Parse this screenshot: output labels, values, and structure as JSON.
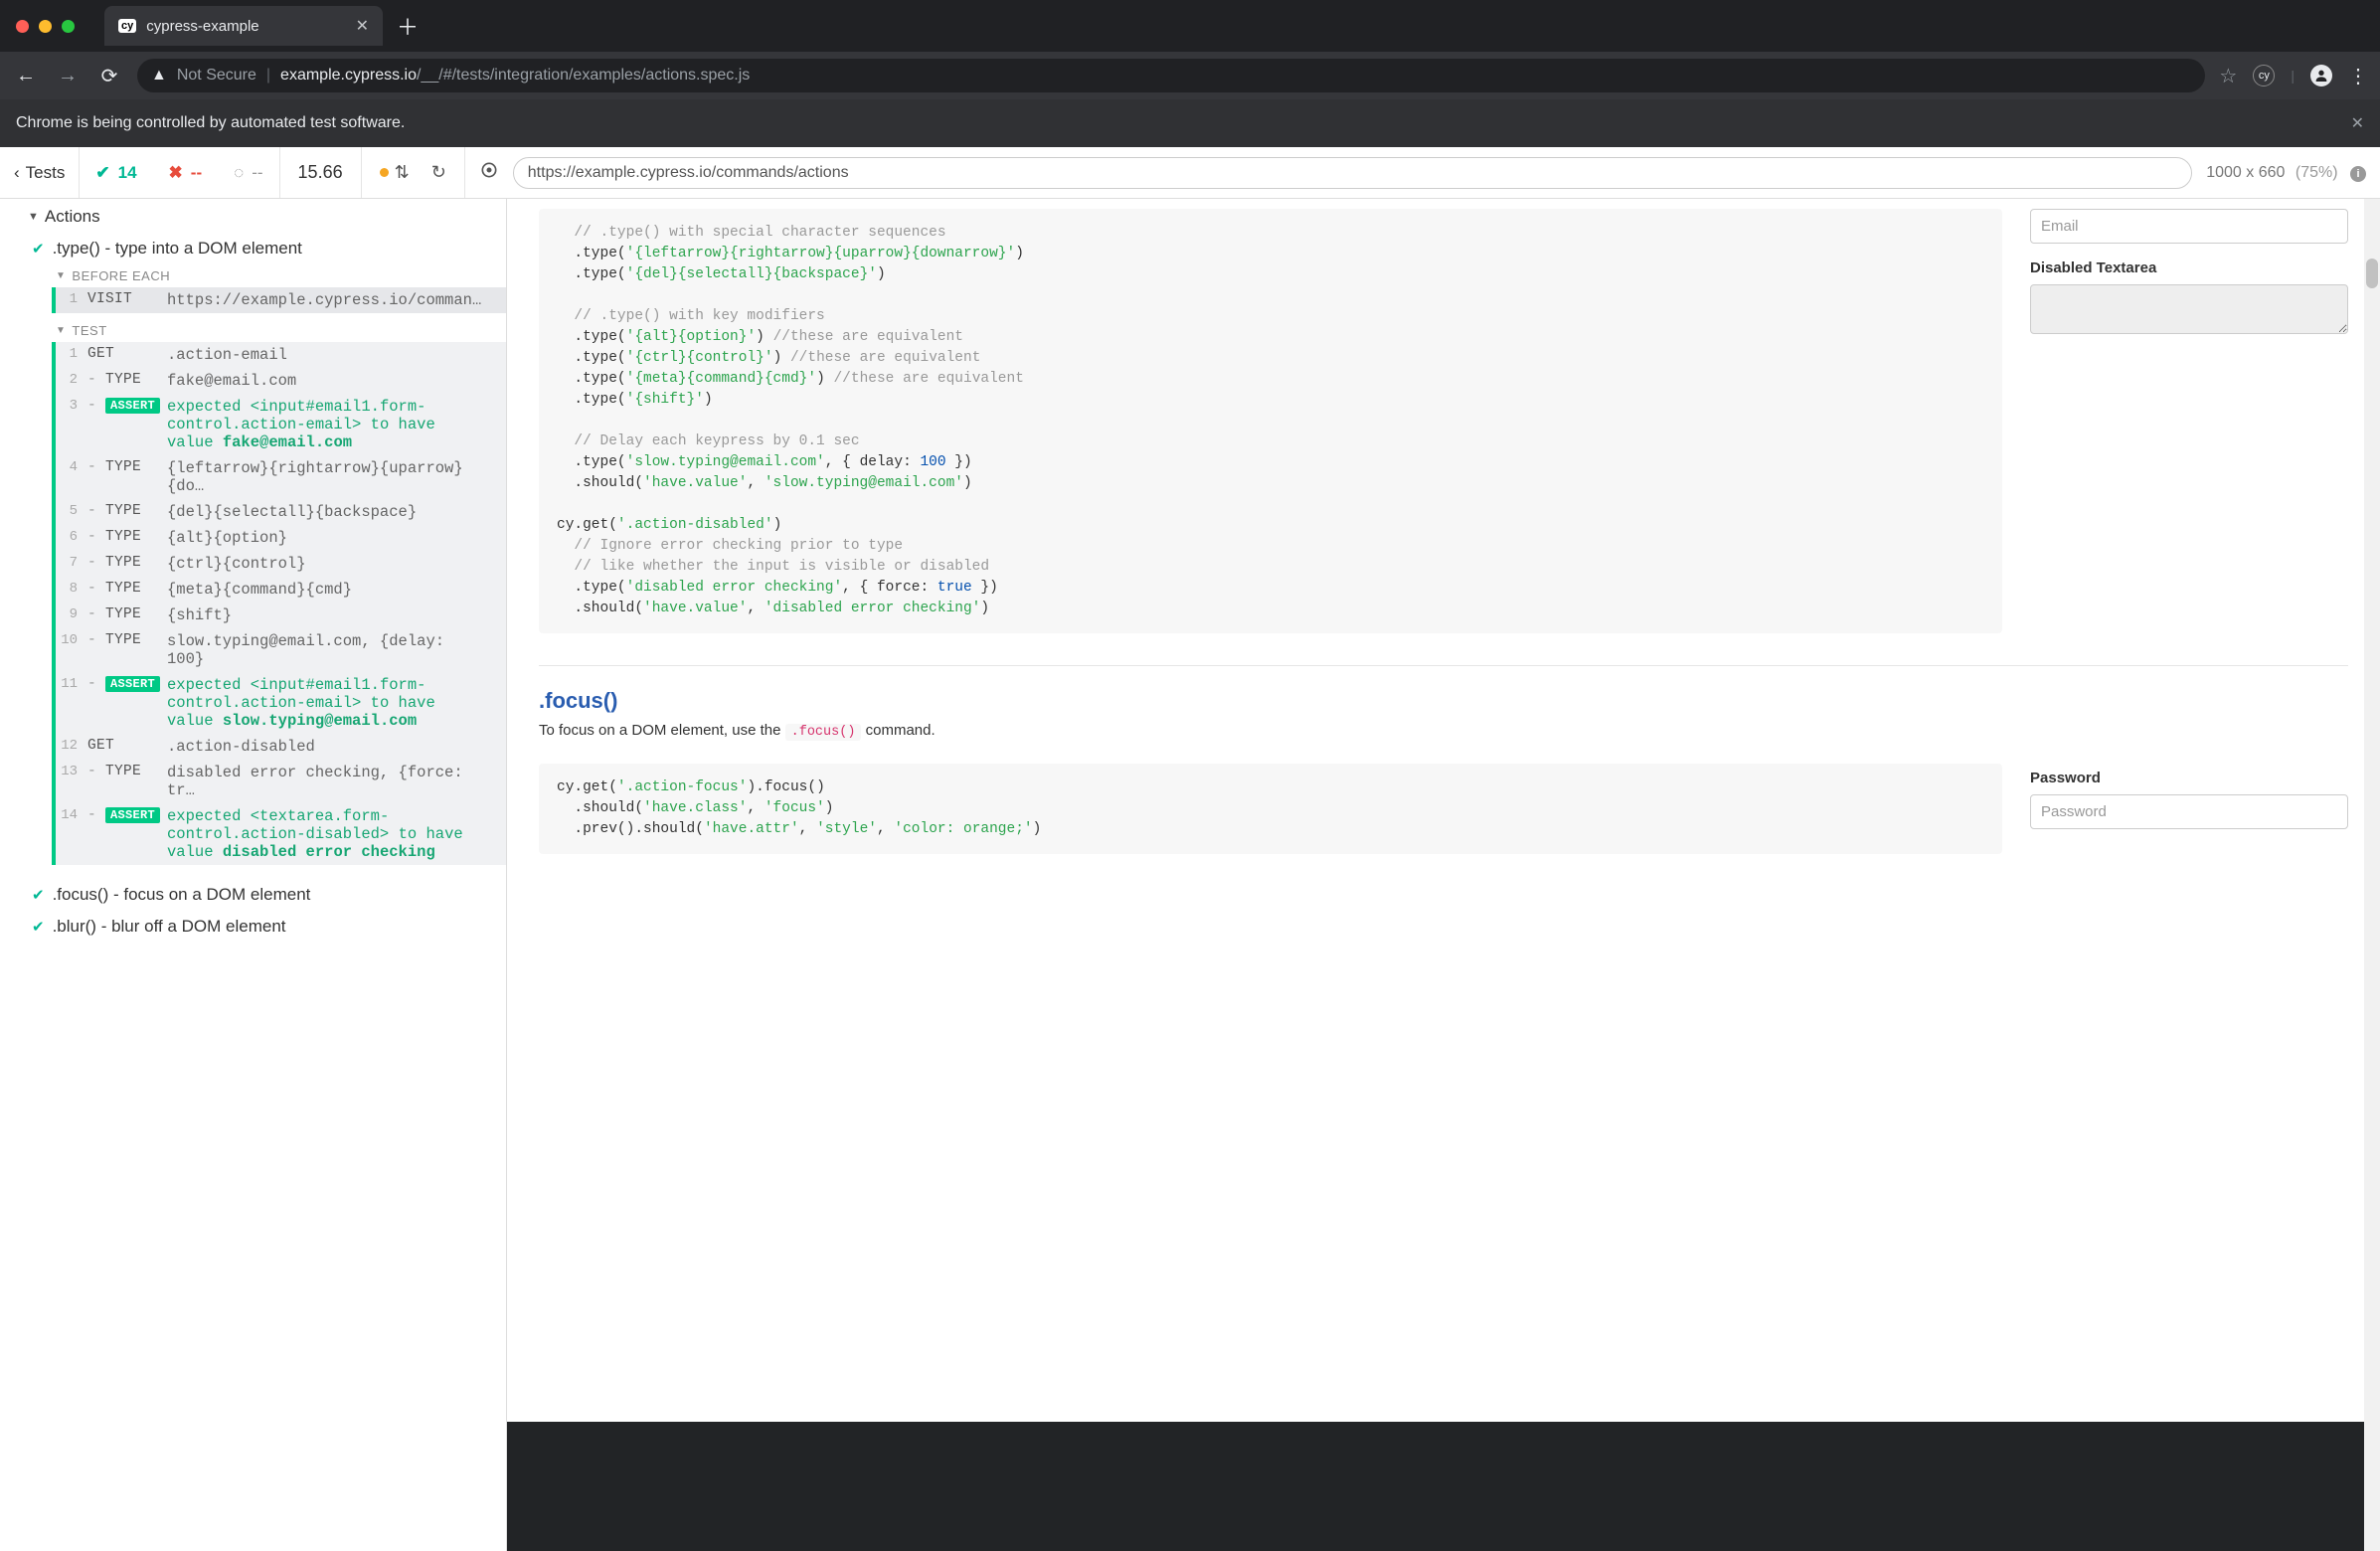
{
  "browser": {
    "tab_favicon": "cy",
    "tab_title": "cypress-example",
    "address_insecure": "Not Secure",
    "address_host": "example.cypress.io",
    "address_path": "/__/#/tests/integration/examples/actions.spec.js",
    "cy_badge": "cy"
  },
  "infobar": {
    "text": "Chrome is being controlled by automated test software."
  },
  "header": {
    "tests_label": "Tests",
    "passed": "14",
    "failed": "--",
    "pending": "--",
    "duration": "15.66",
    "aut_url": "https://example.cypress.io/commands/actions",
    "viewport": "1000 x 660",
    "scale": "(75%)"
  },
  "reporter": {
    "suite": "Actions",
    "tests": [
      {
        "status": "pass",
        "title": ".type() - type into a DOM element"
      },
      {
        "status": "pass",
        "title": ".focus() - focus on a DOM element"
      },
      {
        "status": "pass",
        "title": ".blur() - blur off a DOM element"
      }
    ],
    "hooks": {
      "before_each": "BEFORE EACH",
      "test": "TEST"
    },
    "before_each_cmd": {
      "num": "1",
      "name": "VISIT",
      "msg": "https://example.cypress.io/commands…"
    },
    "cmds": [
      {
        "num": "1",
        "name": "GET",
        "child": false,
        "msg": ".action-email"
      },
      {
        "num": "2",
        "name": "TYPE",
        "child": true,
        "msg": "fake@email.com"
      },
      {
        "num": "3",
        "name": "ASSERT",
        "child": true,
        "assert": true,
        "expected": "expected",
        "el": "<input#email1.form-control.action-email>",
        "kw": "to have value",
        "val": "fake@email.com"
      },
      {
        "num": "4",
        "name": "TYPE",
        "child": true,
        "msg": "{leftarrow}{rightarrow}{uparrow}{do…"
      },
      {
        "num": "5",
        "name": "TYPE",
        "child": true,
        "msg": "{del}{selectall}{backspace}"
      },
      {
        "num": "6",
        "name": "TYPE",
        "child": true,
        "msg": "{alt}{option}"
      },
      {
        "num": "7",
        "name": "TYPE",
        "child": true,
        "msg": "{ctrl}{control}"
      },
      {
        "num": "8",
        "name": "TYPE",
        "child": true,
        "msg": "{meta}{command}{cmd}"
      },
      {
        "num": "9",
        "name": "TYPE",
        "child": true,
        "msg": "{shift}"
      },
      {
        "num": "10",
        "name": "TYPE",
        "child": true,
        "msg": "slow.typing@email.com, {delay: 100}"
      },
      {
        "num": "11",
        "name": "ASSERT",
        "child": true,
        "assert": true,
        "expected": "expected",
        "el": "<input#email1.form-control.action-email>",
        "kw": "to have value",
        "val": "slow.typing@email.com"
      },
      {
        "num": "12",
        "name": "GET",
        "child": false,
        "msg": ".action-disabled"
      },
      {
        "num": "13",
        "name": "TYPE",
        "child": true,
        "msg": "disabled error checking, {force: tr…"
      },
      {
        "num": "14",
        "name": "ASSERT",
        "child": true,
        "assert": true,
        "expected": "expected",
        "el": "<textarea.form-control.action-disabled>",
        "kw": "to have value",
        "val": "disabled error checking"
      }
    ]
  },
  "aut": {
    "email_placeholder": "Email",
    "disabled_label": "Disabled Textarea",
    "focus_title": ".focus()",
    "focus_desc_pre": "To focus on a DOM element, use the ",
    "focus_desc_code": ".focus()",
    "focus_desc_post": " command.",
    "password_label": "Password",
    "password_placeholder": "Password",
    "code1_lines": [
      {
        "t": "  ",
        "c": "// .type() with special character sequences"
      },
      {
        "t": "  .type(",
        "s": "'{leftarrow}{rightarrow}{uparrow}{downarrow}'",
        "t2": ")"
      },
      {
        "t": "  .type(",
        "s": "'{del}{selectall}{backspace}'",
        "t2": ")"
      },
      {
        "blank": true
      },
      {
        "t": "  ",
        "c": "// .type() with key modifiers"
      },
      {
        "t": "  .type(",
        "s": "'{alt}{option}'",
        "t2": ") ",
        "c2": "//these are equivalent"
      },
      {
        "t": "  .type(",
        "s": "'{ctrl}{control}'",
        "t2": ") ",
        "c2": "//these are equivalent"
      },
      {
        "t": "  .type(",
        "s": "'{meta}{command}{cmd}'",
        "t2": ") ",
        "c2": "//these are equivalent"
      },
      {
        "t": "  .type(",
        "s": "'{shift}'",
        "t2": ")"
      },
      {
        "blank": true
      },
      {
        "t": "  ",
        "c": "// Delay each keypress by 0.1 sec"
      },
      {
        "t": "  .type(",
        "s": "'slow.typing@email.com'",
        "t2": ", { delay: ",
        "n": "100",
        "t3": " })"
      },
      {
        "t": "  .should(",
        "s": "'have.value'",
        "t2": ", ",
        "s2": "'slow.typing@email.com'",
        "t3": ")"
      },
      {
        "blank": true
      },
      {
        "t": "cy.get(",
        "s": "'.action-disabled'",
        "t2": ")"
      },
      {
        "t": "  ",
        "c": "// Ignore error checking prior to type"
      },
      {
        "t": "  ",
        "c": "// like whether the input is visible or disabled"
      },
      {
        "t": "  .type(",
        "s": "'disabled error checking'",
        "t2": ", { force: ",
        "b": "true",
        "t3": " })"
      },
      {
        "t": "  .should(",
        "s": "'have.value'",
        "t2": ", ",
        "s2": "'disabled error checking'",
        "t3": ")"
      }
    ],
    "code2_lines": [
      {
        "t": "cy.get(",
        "s": "'.action-focus'",
        "t2": ").focus()"
      },
      {
        "t": "  .should(",
        "s": "'have.class'",
        "t2": ", ",
        "s2": "'focus'",
        "t3": ")"
      },
      {
        "t": "  .prev().should(",
        "s": "'have.attr'",
        "t2": ", ",
        "s2": "'style'",
        "t3": ", ",
        "s3": "'color: orange;'",
        "t4": ")"
      }
    ]
  }
}
